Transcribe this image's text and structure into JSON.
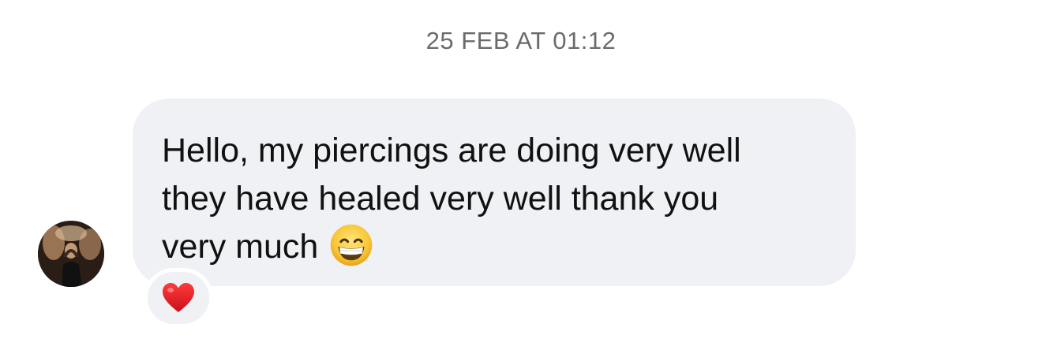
{
  "timestamp": "25 FEB AT 01:12",
  "message": {
    "lines": [
      "Hello, my piercings are doing very well",
      "they have healed very well thank you",
      "very much"
    ],
    "emoji": "grinning-face-icon",
    "bubble_color": "#eff1f5",
    "text_color": "#111111"
  },
  "avatar": {
    "icon": "profile-photo-avatar"
  },
  "reaction": {
    "icon": "red-heart-icon",
    "color": "#e0202a"
  },
  "timestamp_color": "#6b6b6e"
}
